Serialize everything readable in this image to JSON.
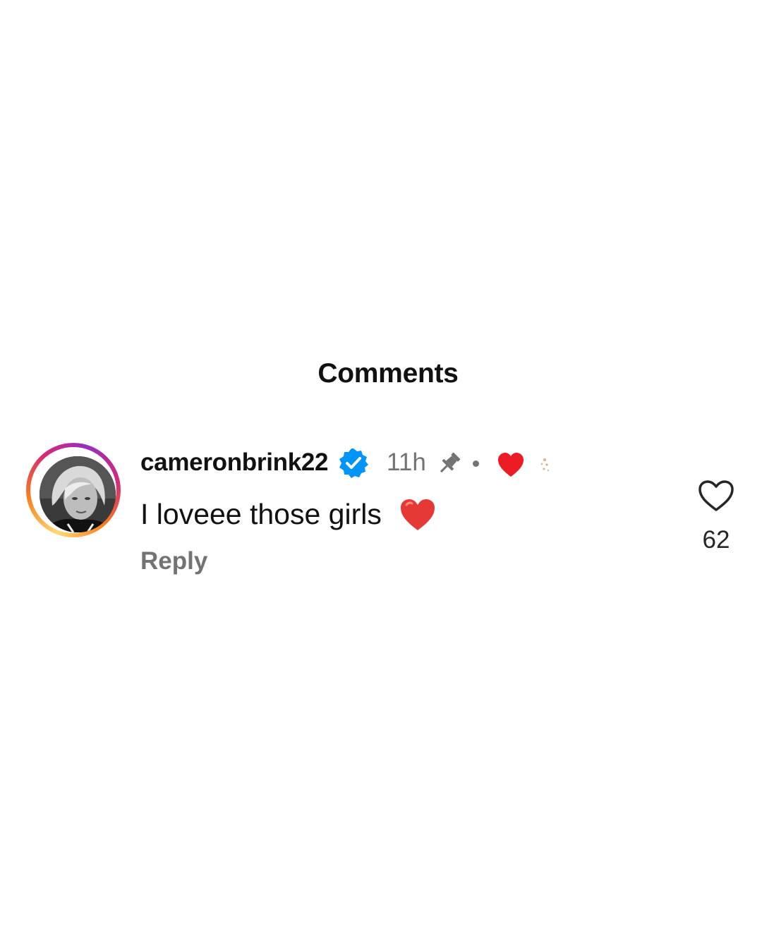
{
  "header": {
    "title": "Comments"
  },
  "comment": {
    "username": "cameronbrink22",
    "verified": true,
    "timestamp": "11h",
    "pinned": true,
    "liked_by_author": true,
    "text": "I loveee those girls",
    "text_emoji": "red-heart",
    "reply_label": "Reply",
    "like_count": "62"
  },
  "colors": {
    "verified_blue": "#0095f6",
    "heart_red": "#ed1c24",
    "secondary_text": "#737373"
  },
  "icons": {
    "verified": "verified-badge-icon",
    "pin": "pin-icon",
    "author_like": "heart-filled-icon",
    "like": "heart-outline-icon"
  }
}
